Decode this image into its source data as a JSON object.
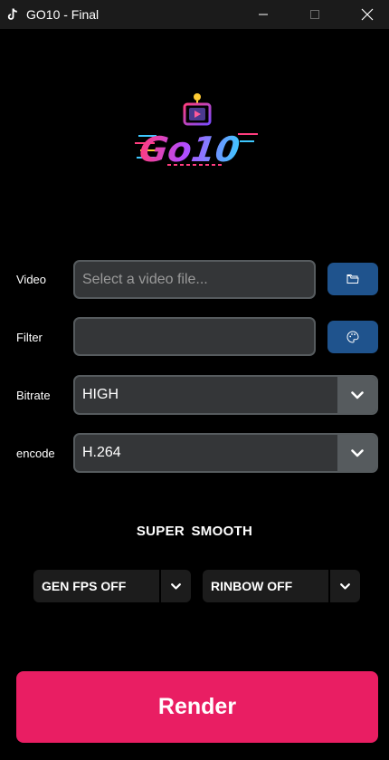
{
  "window": {
    "title": "GO10 - Final"
  },
  "logo": {
    "text": "Go10"
  },
  "form": {
    "video_label": "Video",
    "video_placeholder": "Select a video file...",
    "video_value": "",
    "filter_label": "Filter",
    "filter_value": "",
    "bitrate_label": "Bitrate",
    "bitrate_value": "HIGH",
    "encode_label": "encode",
    "encode_value": "H.264"
  },
  "super_smooth": {
    "title": "SUPER  SMOOTH",
    "gen_fps": "GEN FPS OFF",
    "rainbow": "RINBOW OFF"
  },
  "render_label": "Render",
  "colors": {
    "accent": "#1f538d",
    "render": "#e91e63",
    "field_bg": "#343638",
    "field_border": "#565b5e"
  },
  "icons": [
    "tiktok-icon",
    "minimize-icon",
    "maximize-icon",
    "close-icon",
    "folder-icon",
    "palette-icon",
    "chevron-down-icon"
  ]
}
